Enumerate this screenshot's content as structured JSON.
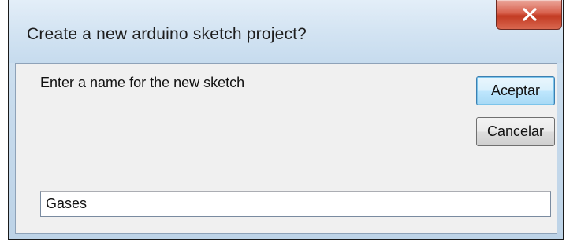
{
  "dialog": {
    "title": "Create a new arduino sketch project?",
    "close_icon": "close-icon",
    "prompt": "Enter a name for the new sketch",
    "ok_label": "Aceptar",
    "cancel_label": "Cancelar",
    "sketch_name_value": "Gases"
  },
  "colors": {
    "close_button": "#c94a36",
    "default_button_border": "#3c7fb1",
    "dialog_background": "#f0f0f0",
    "titlebar": "#d2e3f2"
  }
}
